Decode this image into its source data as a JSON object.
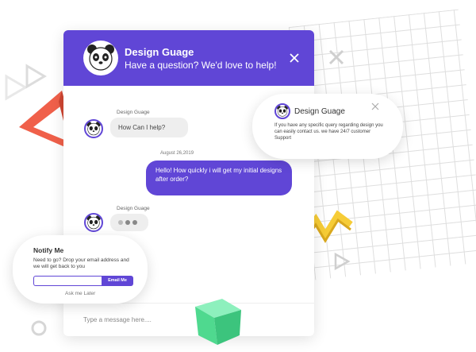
{
  "colors": {
    "accent": "#6046d6",
    "bubble_in": "#eeeeee",
    "triangle": "#f0604a",
    "zigzag": "#f6cc37",
    "cube": "#5ee39c"
  },
  "header": {
    "title": "Design Guage",
    "subtitle": "Have a question? We'd love to help!",
    "close_icon": "close-icon"
  },
  "messages": {
    "first": {
      "sender": "Design Guage",
      "text": "How Can I help?"
    },
    "user": {
      "timestamp": "August 26,2019",
      "text": "Hello! How quickly i will get my initial designs after order?"
    },
    "typing": {
      "sender": "Design Guage"
    }
  },
  "input": {
    "placeholder": "Type a message here...."
  },
  "popup": {
    "title": "Design Guage",
    "body": "If you have any specific query regarding design you can easily contact us. we have 24/7 customer Support"
  },
  "notify": {
    "title": "Notify Me",
    "description": "Need to go? Drop your email address and we will get back to you",
    "email_placeholder": "",
    "button_label": "Email Me",
    "ask_later": "Ask me Later"
  }
}
